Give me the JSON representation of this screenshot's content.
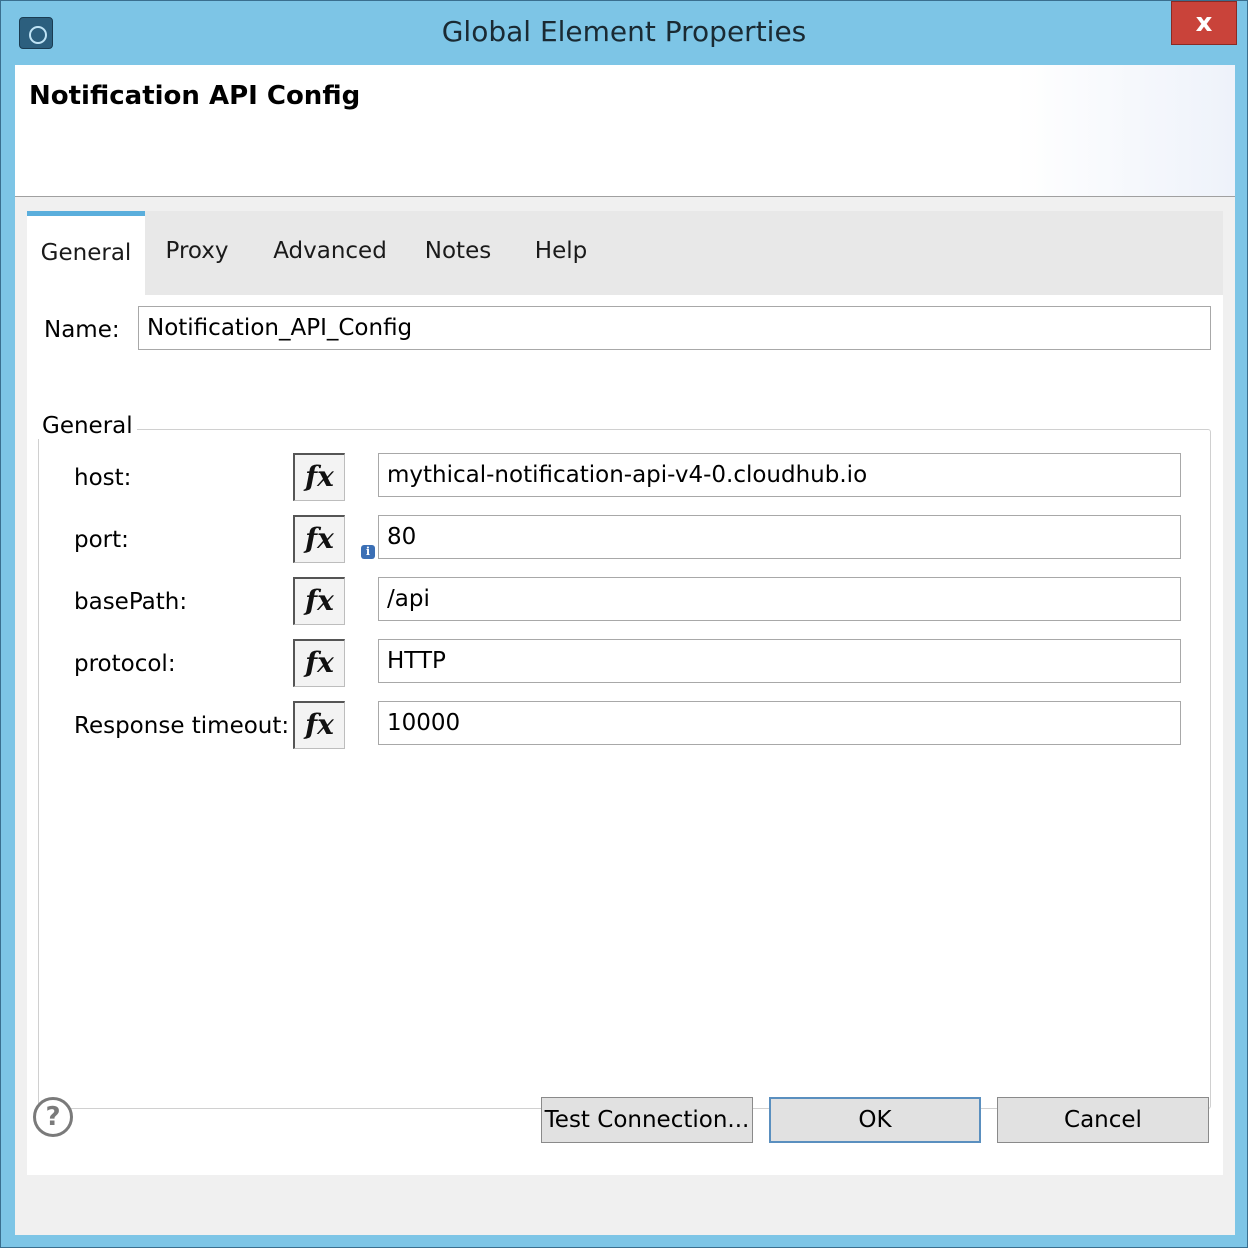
{
  "window": {
    "title": "Global Element Properties",
    "close_label": "x"
  },
  "header": {
    "title": "Notification API Config"
  },
  "tabs": [
    {
      "label": "General",
      "active": true
    },
    {
      "label": "Proxy",
      "active": false
    },
    {
      "label": "Advanced",
      "active": false
    },
    {
      "label": "Notes",
      "active": false
    },
    {
      "label": "Help",
      "active": false
    }
  ],
  "name_field": {
    "label": "Name:",
    "value": "Notification_API_Config"
  },
  "general_group": {
    "legend": "General",
    "fx_label": "fx",
    "info_label": "i",
    "fields": [
      {
        "label": "host:",
        "value": "mythical-notification-api-v4-0.cloudhub.io"
      },
      {
        "label": "port:",
        "value": "80"
      },
      {
        "label": "basePath:",
        "value": "/api"
      },
      {
        "label": "protocol:",
        "value": "HTTP"
      },
      {
        "label": "Response timeout:",
        "value": "10000"
      }
    ]
  },
  "footer": {
    "help_label": "?",
    "test_connection_label": "Test Connection...",
    "ok_label": "OK",
    "cancel_label": "Cancel"
  },
  "colors": {
    "titlebar": "#7dc5e6",
    "close_button": "#c9433a",
    "active_tab_accent": "#5aaedc"
  }
}
